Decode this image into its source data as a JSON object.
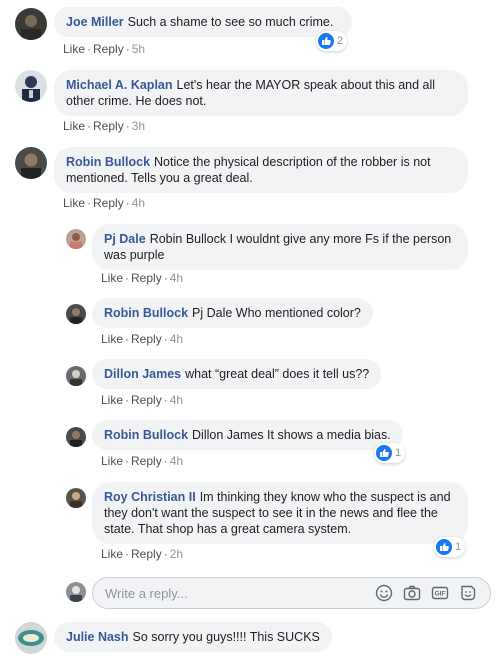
{
  "actions": {
    "like": "Like",
    "reply": "Reply",
    "separator": "·"
  },
  "comments": [
    {
      "author": "Joe Miller",
      "text": "Such a shame to see so much crime.",
      "time": "5h",
      "reactions": "2"
    },
    {
      "author": "Michael A. Kaplan",
      "text": "Let's hear the MAYOR speak about this and all other crime. He does not.",
      "time": "3h"
    },
    {
      "author": "Robin Bullock",
      "text": "Notice the physical description of the robber is not mentioned. Tells you a great deal.",
      "time": "4h"
    }
  ],
  "replies": [
    {
      "author": "Pj Dale",
      "text": "Robin Bullock I wouldnt give any more Fs if the person was purple",
      "time": "4h"
    },
    {
      "author": "Robin Bullock",
      "text": "Pj Dale Who mentioned color?",
      "time": "4h"
    },
    {
      "author": "Dillon James",
      "text": "what “great deal” does it tell us??",
      "time": "4h"
    },
    {
      "author": "Robin Bullock",
      "text": "Dillon James It shows a media bias.",
      "time": "4h",
      "reactions": "1"
    },
    {
      "author": "Roy Christian II",
      "text": "Im thinking they know who the suspect is and they don't want the suspect to see it in the news and flee the state. That shop has a great camera system.",
      "time": "2h",
      "reactions": "1"
    }
  ],
  "reply_box": {
    "placeholder": "Write a reply..."
  },
  "next_comment": {
    "author": "Julie Nash",
    "text": "So sorry you guys!!!! This SUCKS"
  },
  "colors": {
    "author": "#385898",
    "bubble": "#f2f3f5",
    "like_blue": "#1877f2",
    "meta": "#606770"
  },
  "icons": [
    "like-thumb-icon",
    "emoji-icon",
    "camera-icon",
    "gif-icon",
    "sticker-icon"
  ]
}
